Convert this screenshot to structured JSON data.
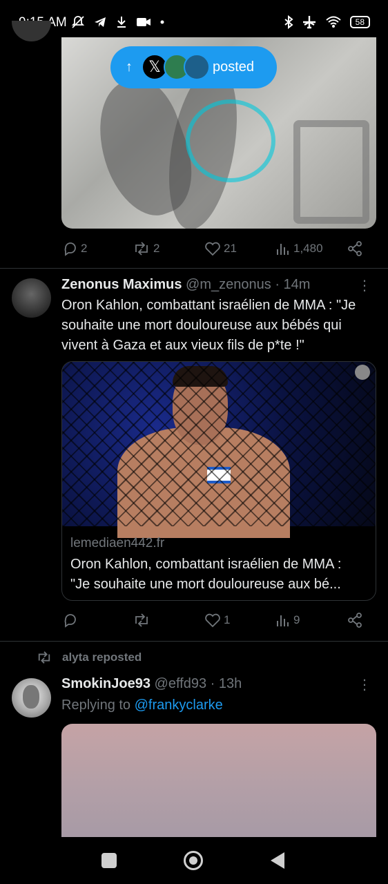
{
  "status_bar": {
    "time": "9:15 AM",
    "left_icons": [
      "mute-icon",
      "telegram-icon",
      "download-icon",
      "video-icon",
      "dot-icon"
    ],
    "right_icons": [
      "bluetooth-icon",
      "airplane-icon",
      "wifi-icon"
    ],
    "battery": "58"
  },
  "posted_pill": {
    "arrow": "↑",
    "x_glyph": "𝕏",
    "label": "posted"
  },
  "top_tweet": {
    "reply_count": "2",
    "retweet_count": "2",
    "like_count": "21",
    "view_count": "1,480"
  },
  "tweet2": {
    "name": "Zenonus Maximus",
    "handle": "@m_zenonus",
    "sep": "·",
    "time": "14m",
    "more": "⋮",
    "text": "Oron Kahlon, combattant israélien de MMA : \"Je souhaite une mort douloureuse aux bébés qui vivent à Gaza et aux vieux fils de p*te !\"",
    "card": {
      "domain": "lemediaen442.fr",
      "line1": "Oron Kahlon, combattant israélien de MMA :",
      "line2": "\"Je souhaite une mort douloureuse aux bé..."
    },
    "reply_count": "",
    "retweet_count": "",
    "like_count": "1",
    "view_count": "9"
  },
  "repost": {
    "label": "alyta reposted"
  },
  "tweet3": {
    "name": "SmokinJoe93",
    "handle": "@effd93",
    "sep": "·",
    "time": "13h",
    "more": "⋮",
    "replying_prefix": "Replying to ",
    "replying_to": "@frankyclarke"
  },
  "icons": {
    "reply": "💬",
    "retweet": "⟲",
    "like": "♡",
    "views": "📊",
    "share": "⇪"
  },
  "colors": {
    "background": "#000000",
    "text": "#e7e9ea",
    "secondary": "#71767b",
    "accent": "#1d9bf0",
    "divider": "#2f3336"
  }
}
